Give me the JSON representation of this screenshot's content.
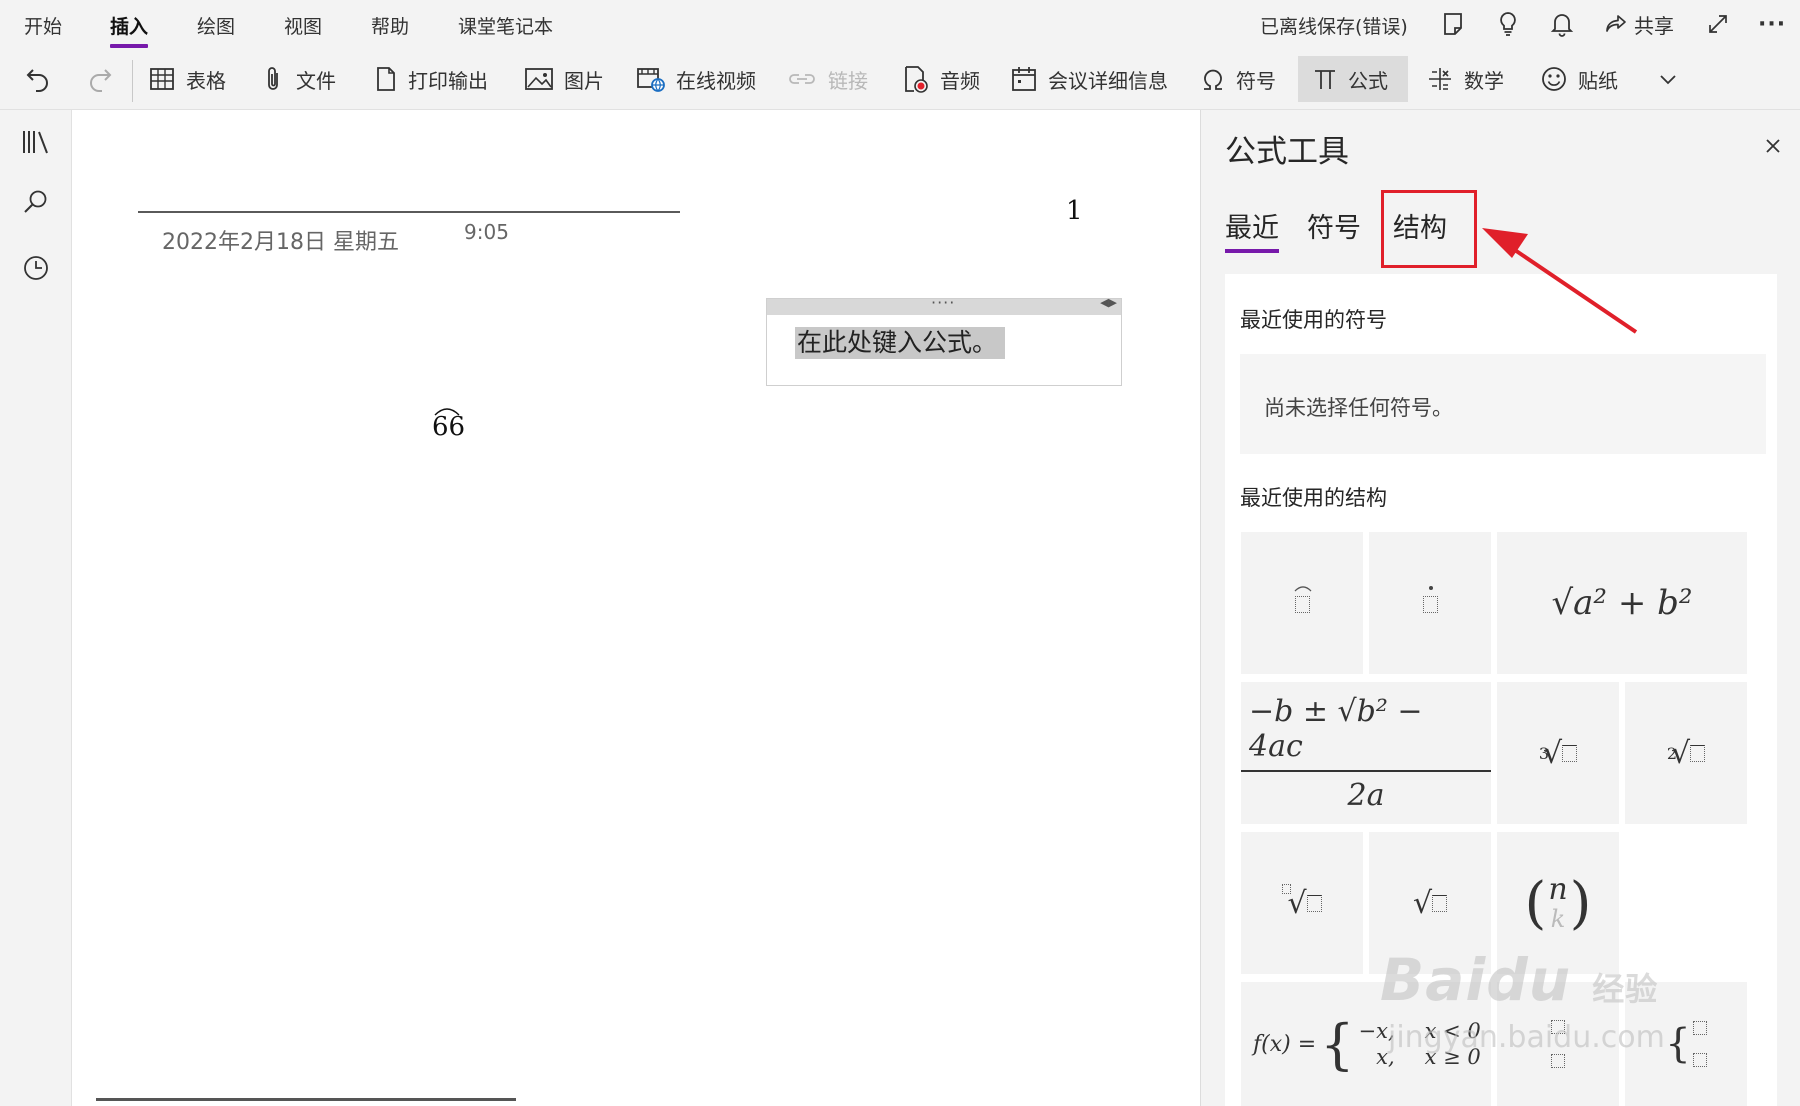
{
  "menu": {
    "tabs": [
      "开始",
      "插入",
      "绘图",
      "视图",
      "帮助",
      "课堂笔记本"
    ],
    "active_tab": "插入",
    "save_status": "已离线保存(错误)",
    "share_label": "共享",
    "more_label": "···"
  },
  "ribbon": {
    "table": "表格",
    "file": "文件",
    "printout": "打印输出",
    "picture": "图片",
    "online_video": "在线视频",
    "link": "链接",
    "audio": "音频",
    "meeting_details": "会议详细信息",
    "symbol": "符号",
    "equation": "公式",
    "math": "数学",
    "sticker": "贴纸"
  },
  "page": {
    "date": "2022年2月18日 星期五",
    "time": "9:05",
    "page_number": "1",
    "equation_placeholder": "在此处键入公式。",
    "equation_handle_dots": "····",
    "arc_value": "66"
  },
  "pane": {
    "title": "公式工具",
    "tabs": [
      "最近",
      "符号",
      "结构"
    ],
    "active_tab": "最近",
    "highlighted_tab": "结构",
    "recent_symbols_heading": "最近使用的符号",
    "no_symbol_message": "尚未选择任何符号。",
    "recent_structures_heading": "最近使用的结构",
    "structures": {
      "pythagoras": "√a² + b²",
      "quadratic_numerator": "−b ± √b² − 4ac",
      "quadratic_denominator": "2a",
      "cube_root_index": "3",
      "square_root_index": "2",
      "binomial_n": "n",
      "binomial_k": "k",
      "piecewise_f": "f(x) =",
      "piecewise_row1": "−x,",
      "piecewise_row1_cond": "x < 0",
      "piecewise_row2": "x,",
      "piecewise_row2_cond": "x ≥ 0"
    }
  },
  "watermark": {
    "brand": "Bai",
    "paw": "du",
    "cn": "经验",
    "url": "jingyan.baidu.com"
  },
  "colors": {
    "accent": "#7719aa",
    "annotation": "#e0202a",
    "chrome": "#f3f3f3"
  }
}
